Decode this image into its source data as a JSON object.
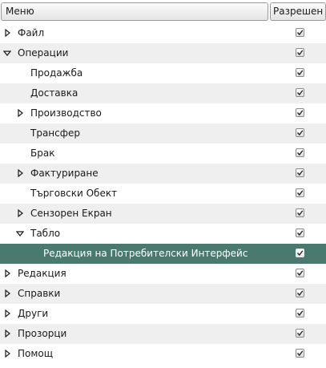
{
  "header": {
    "menu_label": "Меню",
    "allowed_label": "Разрешен"
  },
  "rows": [
    {
      "label": "Файл",
      "level": 0,
      "expander": "collapsed",
      "checked": true,
      "selected": false
    },
    {
      "label": "Операции",
      "level": 0,
      "expander": "expanded",
      "checked": true,
      "selected": false
    },
    {
      "label": "Продажба",
      "level": 1,
      "expander": "none",
      "checked": true,
      "selected": false
    },
    {
      "label": "Доставка",
      "level": 1,
      "expander": "none",
      "checked": true,
      "selected": false
    },
    {
      "label": "Производство",
      "level": 1,
      "expander": "collapsed",
      "checked": true,
      "selected": false
    },
    {
      "label": "Трансфер",
      "level": 1,
      "expander": "none",
      "checked": true,
      "selected": false
    },
    {
      "label": "Брак",
      "level": 1,
      "expander": "none",
      "checked": true,
      "selected": false
    },
    {
      "label": "Фактуриране",
      "level": 1,
      "expander": "collapsed",
      "checked": true,
      "selected": false
    },
    {
      "label": "Търговски Обект",
      "level": 1,
      "expander": "none",
      "checked": true,
      "selected": false
    },
    {
      "label": "Сензорен Екран",
      "level": 1,
      "expander": "collapsed",
      "checked": true,
      "selected": false
    },
    {
      "label": "Табло",
      "level": 1,
      "expander": "expanded",
      "checked": true,
      "selected": false
    },
    {
      "label": "Редакция на Потребителски Интерфейс",
      "level": 2,
      "expander": "none",
      "checked": true,
      "selected": true
    },
    {
      "label": "Редакция",
      "level": 0,
      "expander": "collapsed",
      "checked": true,
      "selected": false
    },
    {
      "label": "Справки",
      "level": 0,
      "expander": "collapsed",
      "checked": true,
      "selected": false
    },
    {
      "label": "Други",
      "level": 0,
      "expander": "collapsed",
      "checked": true,
      "selected": false
    },
    {
      "label": "Прозорци",
      "level": 0,
      "expander": "collapsed",
      "checked": true,
      "selected": false
    },
    {
      "label": "Помощ",
      "level": 0,
      "expander": "collapsed",
      "checked": true,
      "selected": false
    }
  ],
  "colors": {
    "selection": "#4a7a6f",
    "alt_row": "#efefef"
  }
}
